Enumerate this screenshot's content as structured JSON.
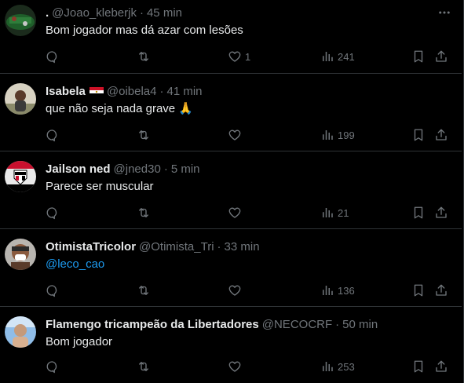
{
  "tweets": [
    {
      "name": ".",
      "handle": "@Joao_kleberjk",
      "dot": "·",
      "time": "45 min",
      "text": "Bom jogador mas dá azar com lesões",
      "likes": "1",
      "views": "241",
      "avatar_colors": [
        "#1f5f2a",
        "#8a3a2a"
      ]
    },
    {
      "name": "Isabela",
      "flag": "flag-egypt",
      "handle": "@oibela4",
      "dot": "·",
      "time": "41 min",
      "text": "que não seja nada grave 🙏",
      "likes": "",
      "views": "199",
      "avatar_colors": [
        "#c9c2b0",
        "#6b6a55"
      ]
    },
    {
      "name": "Jailson ned",
      "handle": "@jned30",
      "dot": "·",
      "time": "5 min",
      "text": "Parece ser muscular",
      "likes": "",
      "views": "21",
      "avatar_colors": [
        "#ffffff",
        "#c8102e"
      ]
    },
    {
      "name": "OtimistaTricolor",
      "handle": "@Otimista_Tri",
      "dot": "·",
      "time": "33 min",
      "text": "@leco_cao",
      "text_is_link": true,
      "likes": "",
      "views": "136",
      "avatar_colors": [
        "#b9b7b4",
        "#5a3b2a"
      ]
    },
    {
      "name": "Flamengo tricampeão da Libertadores",
      "handle": "@NECOCRF",
      "dot": "·",
      "time": "50 min",
      "text": "Bom jogador",
      "likes": "",
      "views": "253",
      "avatar_colors": [
        "#7fb2e5",
        "#c59a7a"
      ]
    }
  ],
  "colors": {
    "background": "#000000",
    "text": "#e7e9ea",
    "muted": "#71767b",
    "link": "#1d9bf0",
    "divider": "#2f3336"
  },
  "icons": {
    "reply": "reply-icon",
    "retweet": "retweet-icon",
    "like": "like-icon",
    "views": "views-icon",
    "bookmark": "bookmark-icon",
    "share": "share-icon",
    "more": "more-icon"
  }
}
